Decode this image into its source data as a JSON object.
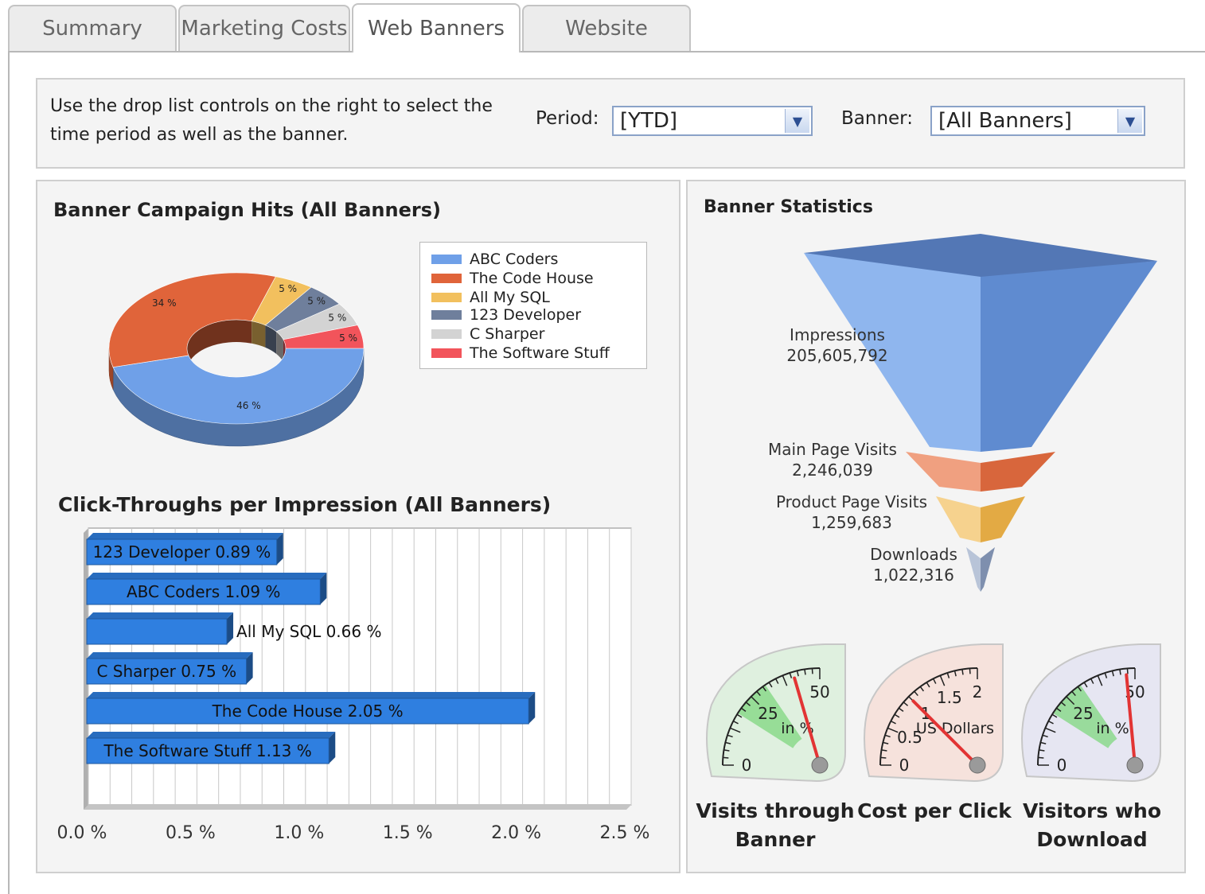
{
  "tabs": [
    {
      "label": "Summary",
      "active": false
    },
    {
      "label": "Marketing Costs",
      "active": false
    },
    {
      "label": "Web Banners",
      "active": true
    },
    {
      "label": "Website",
      "active": false
    }
  ],
  "controls": {
    "instructions": "Use the drop list controls on the right to select the time period as well as the banner.",
    "period_label": "Period:",
    "period_value": "[YTD]",
    "banner_label": "Banner:",
    "banner_value": "[All Banners]"
  },
  "colors": {
    "abc_coders": "#6fa0e8",
    "the_code_house": "#e0643a",
    "all_my_sql": "#f2c05e",
    "dev_123": "#6f7f9c",
    "c_sharper": "#d3d3d3",
    "software_stuff": "#f2545b",
    "bar": "#2f7fe0"
  },
  "chart_data": [
    {
      "type": "pie",
      "title": "Banner Campaign Hits (All Banners)",
      "legend": "right",
      "slices": [
        {
          "name": "ABC Coders",
          "value": 46,
          "label": "46 %"
        },
        {
          "name": "The Code House",
          "value": 34,
          "label": "34 %"
        },
        {
          "name": "All My SQL",
          "value": 5,
          "label": "5 %"
        },
        {
          "name": "123 Developer",
          "value": 5,
          "label": "5 %"
        },
        {
          "name": "C Sharper",
          "value": 5,
          "label": "5 %"
        },
        {
          "name": "The Software Stuff",
          "value": 5,
          "label": "5 %"
        }
      ]
    },
    {
      "type": "bar",
      "orientation": "horizontal",
      "title": "Click-Throughs per Impression (All Banners)",
      "categories": [
        "123 Developer",
        "ABC Coders",
        "All My SQL",
        "C Sharper",
        "The Code House",
        "The Software Stuff"
      ],
      "values": [
        0.89,
        1.09,
        0.66,
        0.75,
        2.05,
        1.13
      ],
      "labels": [
        "123 Developer  0.89 %",
        "ABC Coders  1.09 %",
        "All My SQL  0.66 %",
        "C Sharper  0.75 %",
        "The Code House  2.05 %",
        "The Software Stuff  1.13 %"
      ],
      "xlim": [
        0,
        2.5
      ],
      "xticks": [
        "0.0 %",
        "0.5 %",
        "1.0 %",
        "1.5 %",
        "2.0 %",
        "2.5 %"
      ],
      "grid": true
    },
    {
      "type": "funnel",
      "title": "Banner Statistics",
      "stages": [
        {
          "name": "Impressions",
          "value": "205,605,792"
        },
        {
          "name": "Main Page Visits",
          "value": "2,246,039"
        },
        {
          "name": "Product Page Visits",
          "value": "1,259,683"
        },
        {
          "name": "Downloads",
          "value": "1,022,316"
        }
      ]
    },
    {
      "type": "gauge",
      "gauges": [
        {
          "caption": [
            "Visits through",
            "Banner"
          ],
          "unit": "in %",
          "ticks": [
            "0",
            "25",
            "50"
          ],
          "max": 50,
          "value": 41
        },
        {
          "caption": [
            "Cost per Click"
          ],
          "unit": "US Dollars",
          "ticks": [
            "0",
            "0.5",
            "1",
            "1.5",
            "2"
          ],
          "max": 2,
          "value": 1.0
        },
        {
          "caption": [
            "Visitors who",
            "Download"
          ],
          "unit": "in %",
          "ticks": [
            "0",
            "25",
            "50"
          ],
          "max": 50,
          "value": 47
        }
      ]
    }
  ]
}
